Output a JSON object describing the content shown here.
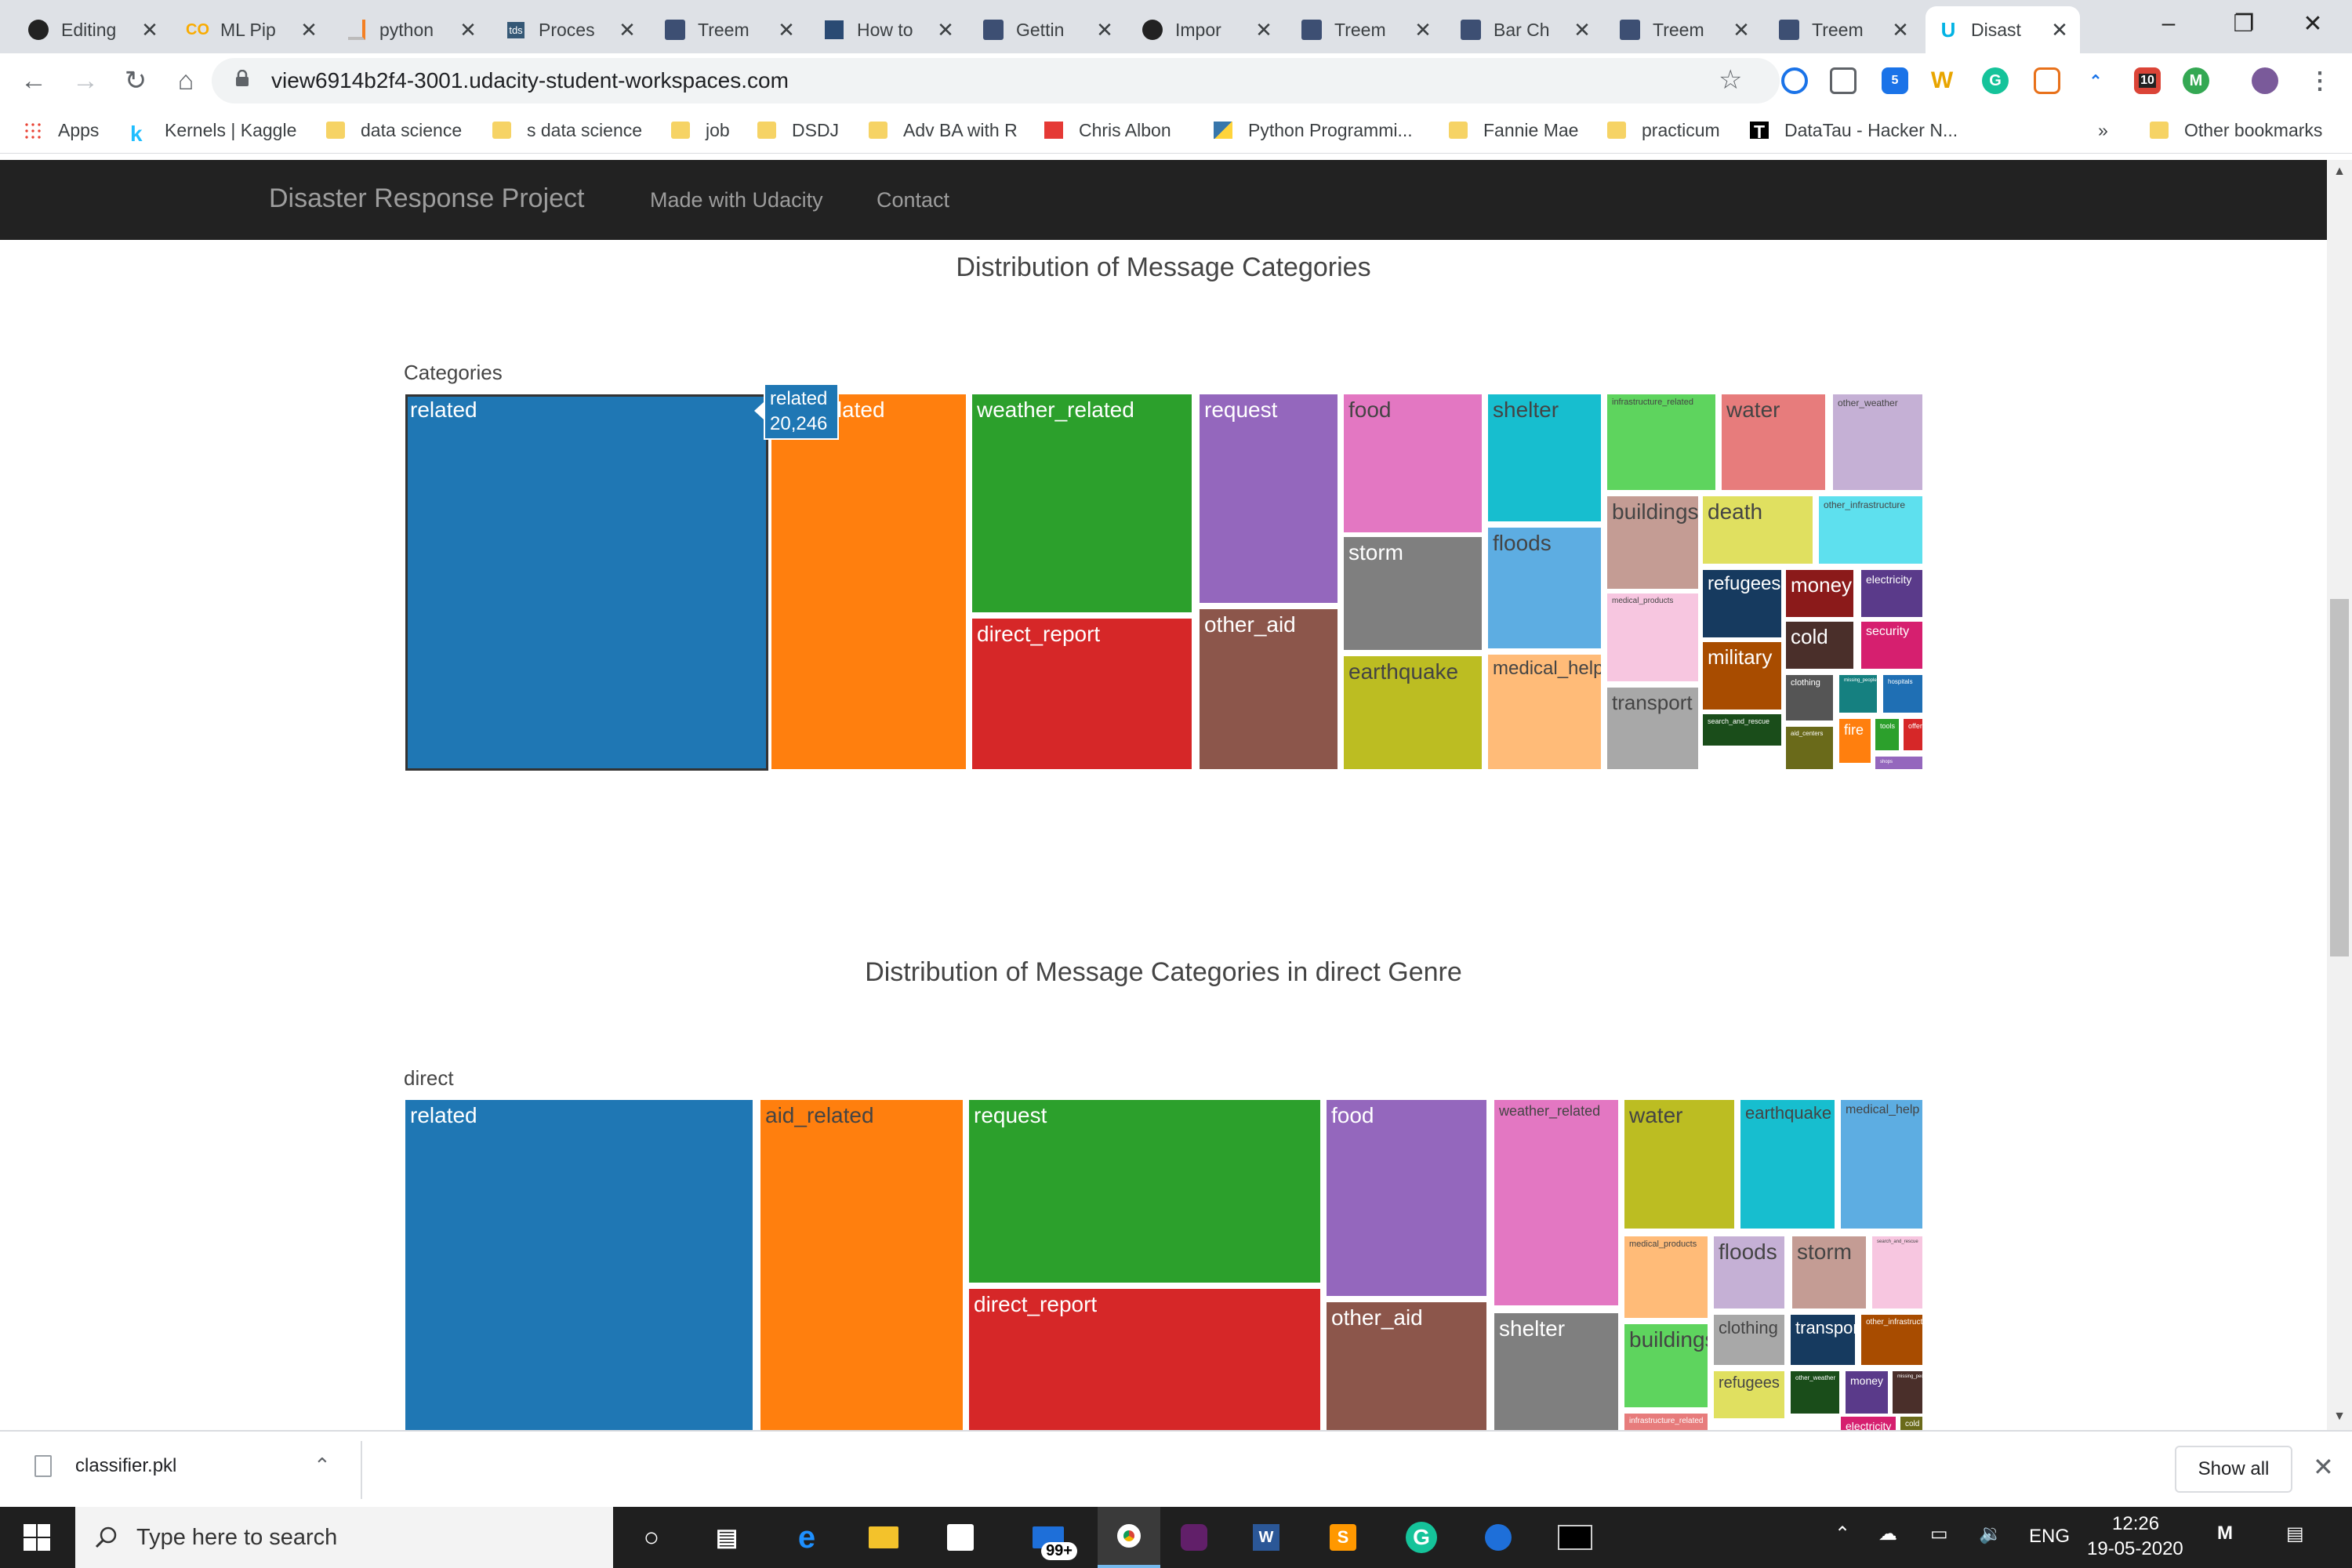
{
  "browser": {
    "tabs": [
      {
        "title": "Editing",
        "icon": "github-icon"
      },
      {
        "title": "ML Pip",
        "icon": "colab-icon"
      },
      {
        "title": "python",
        "icon": "stackoverflow-icon"
      },
      {
        "title": "Proces",
        "icon": "tds-icon",
        "icon_text": "tds"
      },
      {
        "title": "Treem",
        "icon": "plotly-icon"
      },
      {
        "title": "How to",
        "icon": "page-icon"
      },
      {
        "title": "Gettin",
        "icon": "plotly-icon"
      },
      {
        "title": "Impor",
        "icon": "github-icon"
      },
      {
        "title": "Treem",
        "icon": "plotly-icon"
      },
      {
        "title": "Bar Ch",
        "icon": "plotly-icon"
      },
      {
        "title": "Treem",
        "icon": "plotly-icon"
      },
      {
        "title": "Treem",
        "icon": "plotly-icon"
      },
      {
        "title": "Disast",
        "icon": "udacity-icon",
        "active": true
      }
    ],
    "url": "view6914b2f4-3001.udacity-student-workspaces.com",
    "extension_badges": {
      "ext3": "5",
      "ext8": "10"
    },
    "bookmarks": [
      {
        "label": "Apps",
        "icon": "apps-icon"
      },
      {
        "label": "Kernels | Kaggle",
        "icon": "kaggle-icon"
      },
      {
        "label": "data science",
        "icon": "folder-icon"
      },
      {
        "label": "s data science",
        "icon": "folder-icon"
      },
      {
        "label": "job",
        "icon": "folder-icon"
      },
      {
        "label": "DSDJ",
        "icon": "folder-icon"
      },
      {
        "label": "Adv BA with R",
        "icon": "folder-icon"
      },
      {
        "label": "Chris Albon",
        "icon": "red-square-icon"
      },
      {
        "label": "Python Programmi...",
        "icon": "python-icon"
      },
      {
        "label": "Fannie Mae",
        "icon": "folder-icon"
      },
      {
        "label": "practicum",
        "icon": "folder-icon"
      },
      {
        "label": "DataTau - Hacker N...",
        "icon": "datatau-icon"
      }
    ],
    "bookmarks_overflow": "»",
    "other_bookmarks": "Other bookmarks"
  },
  "app": {
    "brand": "Disaster Response Project",
    "nav": [
      "Made with Udacity",
      "Contact"
    ]
  },
  "chart_data": [
    {
      "type": "treemap",
      "title": "Distribution of Message Categories",
      "root": "Categories",
      "hover": {
        "label": "related",
        "value": "20,246"
      },
      "cells": [
        {
          "label": "related",
          "color": "#1f77b4",
          "value": 20246
        },
        {
          "label": "aid_related",
          "color": "#ff7f0e"
        },
        {
          "label": "weather_related",
          "color": "#2ca02c"
        },
        {
          "label": "direct_report",
          "color": "#d62728"
        },
        {
          "label": "request",
          "color": "#9467bd"
        },
        {
          "label": "other_aid",
          "color": "#8c564b"
        },
        {
          "label": "food",
          "color": "#e377c2"
        },
        {
          "label": "storm",
          "color": "#7f7f7f"
        },
        {
          "label": "earthquake",
          "color": "#bcbd22"
        },
        {
          "label": "shelter",
          "color": "#17becf"
        },
        {
          "label": "floods",
          "color": "#5dade2"
        },
        {
          "label": "medical_help",
          "color": "#ffbb78"
        },
        {
          "label": "infrastructure_related",
          "color": "#5ed45e"
        },
        {
          "label": "water",
          "color": "#e77c7c"
        },
        {
          "label": "other_weather",
          "color": "#c5b0d5"
        },
        {
          "label": "buildings",
          "color": "#c49c94"
        },
        {
          "label": "death",
          "color": "#e0e060"
        },
        {
          "label": "other_infrastructure",
          "color": "#5ee0ee"
        },
        {
          "label": "medical_products",
          "color": "#f7c6e0"
        },
        {
          "label": "transport",
          "color": "#a8a8a8"
        },
        {
          "label": "refugees",
          "color": "#163a5f"
        },
        {
          "label": "money",
          "color": "#8b1a1a"
        },
        {
          "label": "electricity",
          "color": "#5a3a8a"
        },
        {
          "label": "military",
          "color": "#a84c00"
        },
        {
          "label": "cold",
          "color": "#4a2f2a"
        },
        {
          "label": "security",
          "color": "#d61f6f"
        },
        {
          "label": "clothing",
          "color": "#555555"
        },
        {
          "label": "missing_people",
          "color": "#158080"
        },
        {
          "label": "hospitals",
          "color": "#1f6fb4"
        },
        {
          "label": "search_and_rescue",
          "color": "#1a4d1a"
        },
        {
          "label": "aid_centers",
          "color": "#6a6a1a"
        },
        {
          "label": "fire",
          "color": "#ff7f0e"
        },
        {
          "label": "tools",
          "color": "#2ca02c"
        },
        {
          "label": "offer",
          "color": "#d62728"
        },
        {
          "label": "shops",
          "color": "#9467bd"
        }
      ]
    },
    {
      "type": "treemap",
      "title": "Distribution of Message Categories in direct Genre",
      "root": "direct",
      "cells": [
        {
          "label": "related",
          "color": "#1f77b4"
        },
        {
          "label": "aid_related",
          "color": "#ff7f0e"
        },
        {
          "label": "request",
          "color": "#2ca02c"
        },
        {
          "label": "direct_report",
          "color": "#d62728"
        },
        {
          "label": "food",
          "color": "#9467bd"
        },
        {
          "label": "other_aid",
          "color": "#8c564b"
        },
        {
          "label": "weather_related",
          "color": "#e377c2"
        },
        {
          "label": "shelter",
          "color": "#7f7f7f"
        },
        {
          "label": "water",
          "color": "#bcbd22"
        },
        {
          "label": "earthquake",
          "color": "#17becf"
        },
        {
          "label": "medical_help",
          "color": "#5dade2"
        },
        {
          "label": "medical_products",
          "color": "#ffbb78"
        },
        {
          "label": "floods",
          "color": "#c5b0d5"
        },
        {
          "label": "storm",
          "color": "#c49c94"
        },
        {
          "label": "search_and_rescue",
          "color": "#f7c6e0"
        },
        {
          "label": "buildings",
          "color": "#5ed45e"
        },
        {
          "label": "clothing",
          "color": "#a8a8a8"
        },
        {
          "label": "transport",
          "color": "#163a5f"
        },
        {
          "label": "other_infrastructure",
          "color": "#a84c00"
        },
        {
          "label": "refugees",
          "color": "#e0e060"
        },
        {
          "label": "other_weather",
          "color": "#1a4d1a"
        },
        {
          "label": "money",
          "color": "#5a3a8a"
        },
        {
          "label": "missing_people",
          "color": "#4a2f2a"
        },
        {
          "label": "infrastructure_related",
          "color": "#e77c7c"
        },
        {
          "label": "electricity",
          "color": "#d61f6f"
        },
        {
          "label": "cold",
          "color": "#6a6a1a"
        }
      ]
    }
  ],
  "download": {
    "file": "classifier.pkl",
    "show_all": "Show all"
  },
  "taskbar": {
    "search_placeholder": "Type here to search",
    "mail_badge": "99+",
    "lang": "ENG",
    "time": "12:26",
    "date": "19-05-2020"
  }
}
